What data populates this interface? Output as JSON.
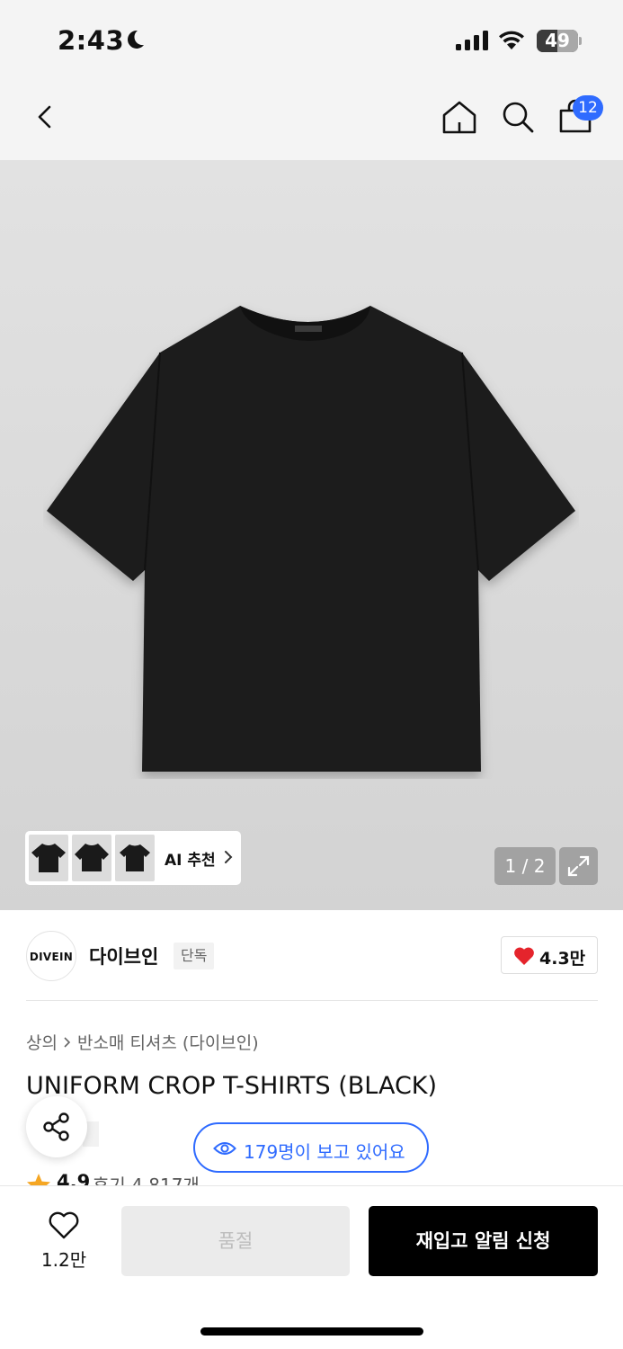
{
  "status_bar": {
    "time": "2:43",
    "battery": "49",
    "battery_level": 0.49,
    "icons": [
      "moon-icon",
      "cellular-signal-icon",
      "wifi-icon",
      "battery-icon"
    ]
  },
  "nav": {
    "icons": [
      "back-arrow-icon",
      "home-icon",
      "search-icon",
      "shopping-bag-icon"
    ],
    "cart_count": "12",
    "badge_color": "#2f6bff"
  },
  "gallery": {
    "ai_label": "AI 추천",
    "page_indicator": "1 / 2",
    "thumbnail_count": 3
  },
  "brand": {
    "logo_text": "DIVEIN",
    "name": "다이브인",
    "badge": "단독",
    "likes": "4.3만"
  },
  "product": {
    "breadcrumb": [
      "상의",
      "반소매 티셔츠 (다이브인)"
    ],
    "title": "UNIFORM CROP T-SHIRTS (BLACK)",
    "viewers_text": "179명이 보고 있어요",
    "accent_color": "#2f6bff",
    "rating": "4.9",
    "reviews": "후기 4,817개"
  },
  "bottom_bar": {
    "wish_count": "1.2만",
    "soldout_label": "품절",
    "restock_label": "재입고 알림 신청"
  }
}
